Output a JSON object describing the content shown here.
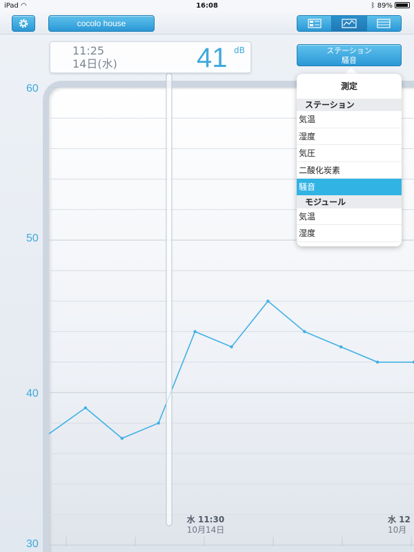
{
  "status": {
    "device": "iPad",
    "time": "16:08",
    "battery": "89%"
  },
  "toolbar": {
    "home_name": "cocolo house"
  },
  "readout": {
    "time": "11:25",
    "date": "14日(水)",
    "value": "41",
    "unit": "dB"
  },
  "station_button": {
    "line1": "ステーション",
    "line2": "騒音"
  },
  "dropdown": {
    "title": "測定",
    "section1": "ステーション",
    "station_items": [
      "気温",
      "湿度",
      "気圧",
      "二酸化炭素",
      "騒音"
    ],
    "selected": "騒音",
    "section2": "モジュール",
    "module_items": [
      "気温",
      "湿度"
    ]
  },
  "colors": {
    "accent": "#3fa9dc",
    "selected": "#31b3e4"
  },
  "chart_data": {
    "type": "line",
    "ylim": [
      30,
      60
    ],
    "y_ticks": [
      "60",
      "50",
      "40",
      "30"
    ],
    "x_labels": [
      {
        "day": "水 11:30",
        "date": "10月14日"
      },
      {
        "day": "水 12",
        "date": "10月"
      }
    ],
    "series": [
      {
        "values": [
          37.3,
          39,
          37,
          38,
          44,
          43,
          46,
          44,
          43,
          42,
          42
        ]
      }
    ]
  }
}
